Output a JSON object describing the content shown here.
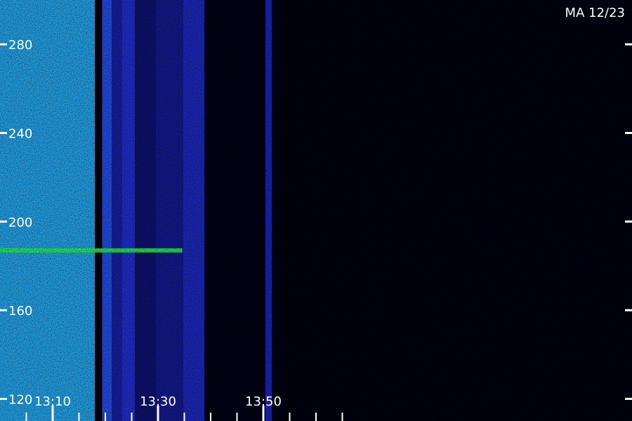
{
  "chart_data": {
    "type": "heatmap",
    "station_label": "MA 12/23",
    "y_ticks": [
      {
        "value": 120,
        "label": "120"
      },
      {
        "value": 160,
        "label": "160"
      },
      {
        "value": 200,
        "label": "200"
      },
      {
        "value": 240,
        "label": "240"
      },
      {
        "value": 280,
        "label": "280"
      }
    ],
    "ylim": [
      110,
      300
    ],
    "xlim_minutes": [
      795,
      855
    ],
    "x_major_ticks": [
      {
        "minute": 800,
        "label": "13:10"
      },
      {
        "minute": 810,
        "label": "13:30"
      },
      {
        "minute": 820,
        "label": "13:50"
      }
    ],
    "x_minor_tick_minutes": [
      797.5,
      802.5,
      805,
      807.5,
      812.5,
      815,
      817.5,
      822.5,
      825,
      827.5
    ],
    "grid": false,
    "colors": {
      "background": "#000000",
      "low": "#0a0a55",
      "mid": "#2233dd",
      "high": "#22bbdd",
      "peak": "#22ee44",
      "axis": "#ffffff"
    },
    "intensity_bands": [
      {
        "minute_start": 795.0,
        "minute_end": 804.0,
        "intensity": 0.78
      },
      {
        "minute_start": 804.0,
        "minute_end": 804.7,
        "intensity": 0.04
      },
      {
        "minute_start": 804.7,
        "minute_end": 805.6,
        "intensity": 0.6
      },
      {
        "minute_start": 805.6,
        "minute_end": 806.6,
        "intensity": 0.4
      },
      {
        "minute_start": 806.6,
        "minute_end": 807.8,
        "intensity": 0.5
      },
      {
        "minute_start": 807.8,
        "minute_end": 809.8,
        "intensity": 0.3
      },
      {
        "minute_start": 809.8,
        "minute_end": 812.4,
        "intensity": 0.36
      },
      {
        "minute_start": 812.4,
        "minute_end": 814.4,
        "intensity": 0.46
      },
      {
        "minute_start": 814.4,
        "minute_end": 820.2,
        "intensity": 0.06
      },
      {
        "minute_start": 820.2,
        "minute_end": 820.8,
        "intensity": 0.44
      },
      {
        "minute_start": 820.8,
        "minute_end": 855.0,
        "intensity": 0.05
      }
    ],
    "emission_lines": [
      {
        "frequency": 187,
        "minute_start": 795.0,
        "minute_end": 812.3,
        "intensity": 1.0
      }
    ]
  }
}
